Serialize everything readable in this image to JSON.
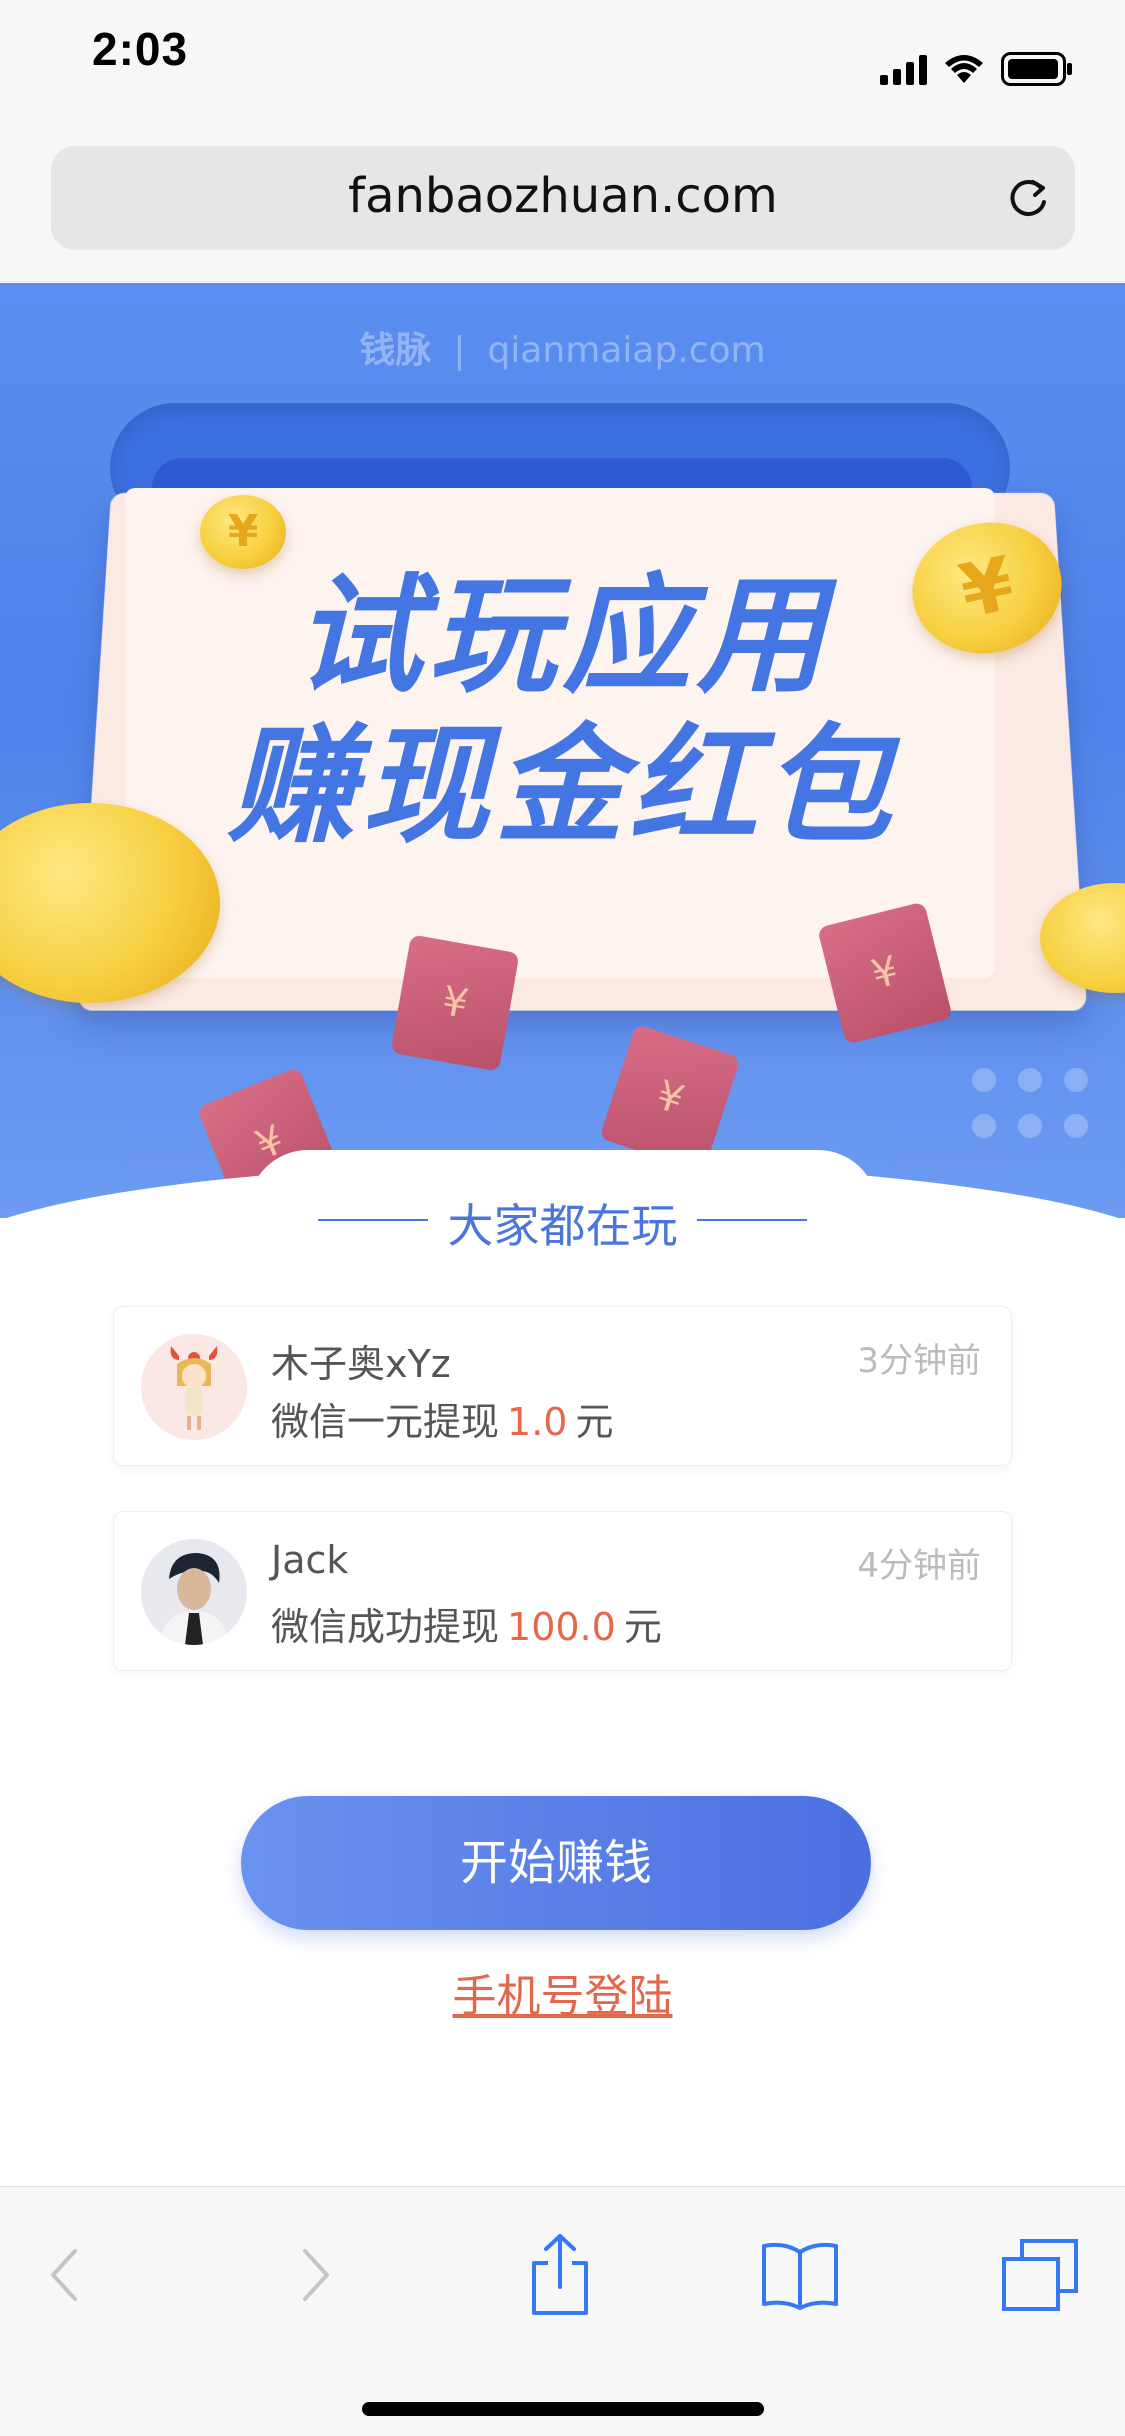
{
  "status_bar": {
    "time": "2:03",
    "icons": [
      "signal-icon",
      "wifi-icon",
      "battery-icon"
    ]
  },
  "browser": {
    "url": "fanbaozhuan.com",
    "reload_icon": "reload-icon"
  },
  "banner": {
    "brand_name": "钱脉",
    "brand_separator": "|",
    "brand_domain": "qianmaiap.com",
    "title_line1": "试玩应用",
    "title_line2": "赚现金红包",
    "coin_symbol": "¥"
  },
  "section": {
    "title": "大家都在玩"
  },
  "activity": [
    {
      "name": "木子奥xYz",
      "prefix": "微信一元提现",
      "amount": "1.0",
      "unit": "元",
      "time": "3分钟前"
    },
    {
      "name": "Jack",
      "prefix": "微信成功提现",
      "amount": "100.0",
      "unit": "元",
      "time": "4分钟前"
    }
  ],
  "actions": {
    "start_button": "开始赚钱",
    "phone_login": "手机号登陆"
  },
  "toolbar": {
    "items": [
      "back-icon",
      "forward-icon",
      "share-icon",
      "bookmarks-icon",
      "tabs-icon"
    ]
  },
  "colors": {
    "primary_blue": "#4a76dc",
    "amount_red": "#e8664a",
    "banner_blue": "#5b8ef0"
  }
}
